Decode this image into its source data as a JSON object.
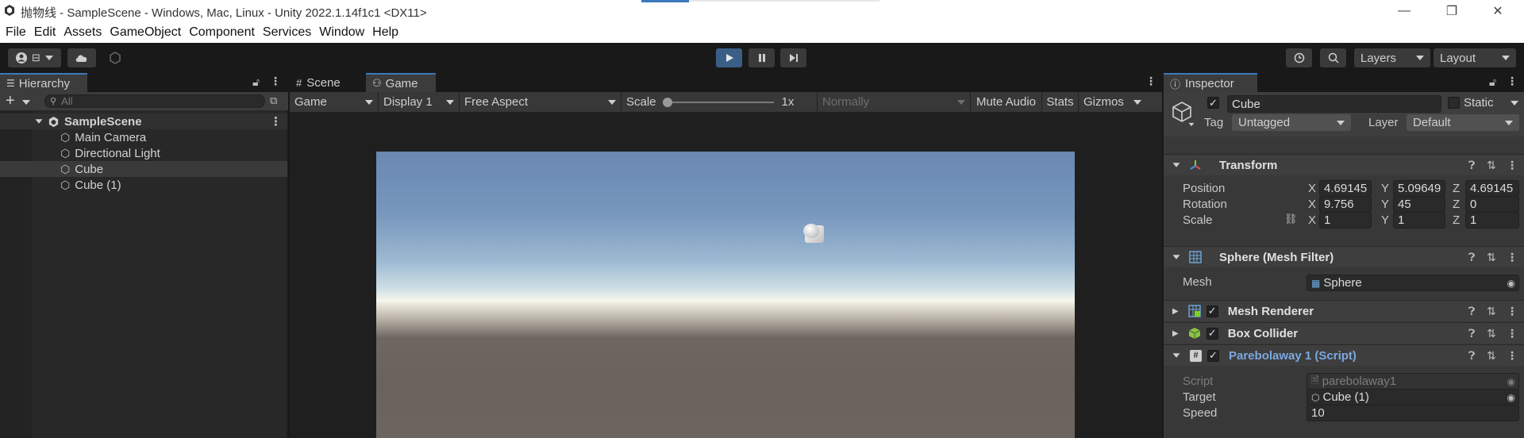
{
  "window": {
    "title": "抛物线 - SampleScene - Windows, Mac, Linux - Unity 2022.1.14f1c1 <DX11>",
    "minimize": "—",
    "restore": "❐",
    "close": "✕"
  },
  "menu": [
    "File",
    "Edit",
    "Assets",
    "GameObject",
    "Component",
    "Services",
    "Window",
    "Help"
  ],
  "toolbar": {
    "account_icon": "account-icon",
    "layers": "Layers",
    "layout": "Layout",
    "accent": "#3a79bb"
  },
  "hierarchy": {
    "tab": "Hierarchy",
    "search_placeholder": "All",
    "scene": "SampleScene",
    "items": [
      "Main Camera",
      "Directional Light",
      "Cube",
      "Cube (1)"
    ],
    "selected_index": 2
  },
  "game_view": {
    "tabs": [
      "Scene",
      "Game"
    ],
    "active_tab": "Game",
    "mode": "Game",
    "display": "Display 1",
    "aspect": "Free Aspect",
    "scale_label": "Scale",
    "scale_value": "1x",
    "normally": "Normally",
    "mute_audio": "Mute Audio",
    "stats": "Stats",
    "gizmos": "Gizmos"
  },
  "inspector": {
    "tab": "Inspector",
    "object_name": "Cube",
    "static_label": "Static",
    "tag_label": "Tag",
    "tag_value": "Untagged",
    "layer_label": "Layer",
    "layer_value": "Default",
    "transform": {
      "title": "Transform",
      "position_label": "Position",
      "rotation_label": "Rotation",
      "scale_label": "Scale",
      "position": [
        "4.69145",
        "5.09649",
        "4.69145"
      ],
      "rotation": [
        "9.756",
        "45",
        "0"
      ],
      "scale": [
        "1",
        "1",
        "1"
      ],
      "axis_x": "X",
      "axis_y": "Y",
      "axis_z": "Z"
    },
    "mesh_filter": {
      "title": "Sphere (Mesh Filter)",
      "mesh_label": "Mesh",
      "mesh_value": "Sphere"
    },
    "mesh_renderer": {
      "title": "Mesh Renderer"
    },
    "box_collider": {
      "title": "Box Collider"
    },
    "script": {
      "title": "Parebolaway 1 (Script)",
      "script_label": "Script",
      "script_value": "parebolaway1",
      "target_label": "Target",
      "target_value": "Cube (1)",
      "speed_label": "Speed",
      "speed_value": "10"
    }
  }
}
